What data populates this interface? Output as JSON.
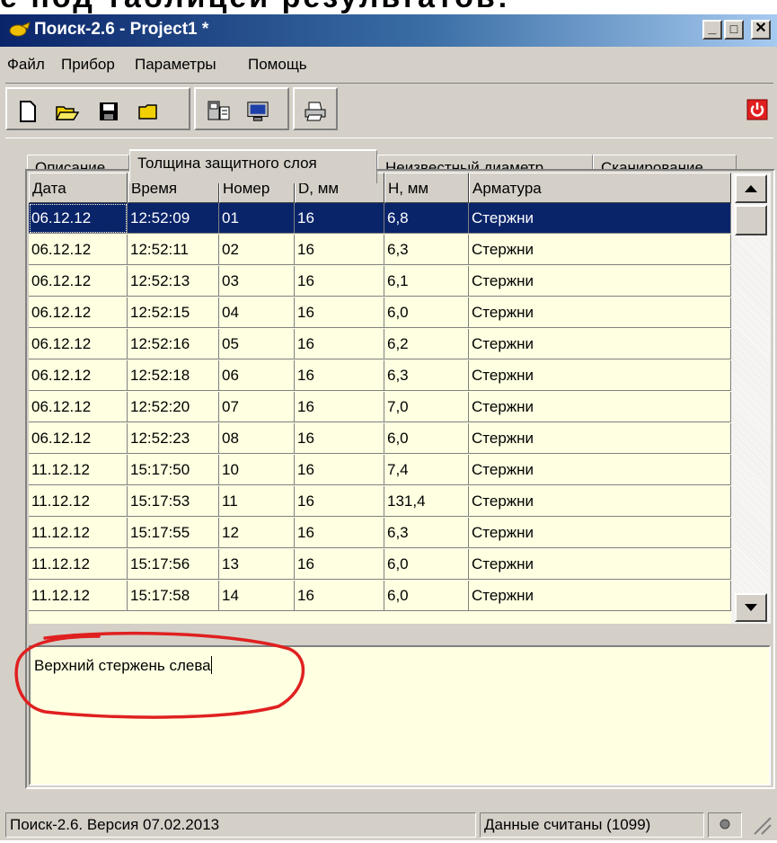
{
  "partial_caption": "е под таблицей результатов:",
  "window": {
    "title": "Поиск-2.6 - Project1 *",
    "controls": {
      "minimize": "_",
      "maximize": "□",
      "close": "✕"
    }
  },
  "menu": [
    "Файл",
    "Прибор",
    "Параметры",
    "Помощь"
  ],
  "toolbar": {
    "icons": [
      "new-file-icon",
      "open-folder-icon",
      "save-icon",
      "folder-icon",
      "device-read-icon",
      "monitor-icon",
      "print-icon",
      "power-icon"
    ],
    "colors": {
      "power": "#e02020"
    }
  },
  "tabs": [
    {
      "label": "Описание",
      "active": false
    },
    {
      "label": "Толщина защитного слоя",
      "active": true
    },
    {
      "label": "Неизвестный диаметр",
      "active": false
    },
    {
      "label": "Сканирование",
      "active": false
    }
  ],
  "table": {
    "columns": [
      "Дата",
      "Время",
      "Номер",
      "D, мм",
      "H, мм",
      "Арматура"
    ],
    "rows": [
      [
        "06.12.12",
        "12:52:09",
        "01",
        "16",
        "6,8",
        "Стержни"
      ],
      [
        "06.12.12",
        "12:52:11",
        "02",
        "16",
        "6,3",
        "Стержни"
      ],
      [
        "06.12.12",
        "12:52:13",
        "03",
        "16",
        "6,1",
        "Стержни"
      ],
      [
        "06.12.12",
        "12:52:15",
        "04",
        "16",
        "6,0",
        "Стержни"
      ],
      [
        "06.12.12",
        "12:52:16",
        "05",
        "16",
        "6,2",
        "Стержни"
      ],
      [
        "06.12.12",
        "12:52:18",
        "06",
        "16",
        "6,3",
        "Стержни"
      ],
      [
        "06.12.12",
        "12:52:20",
        "07",
        "16",
        "7,0",
        "Стержни"
      ],
      [
        "06.12.12",
        "12:52:23",
        "08",
        "16",
        "6,0",
        "Стержни"
      ],
      [
        "11.12.12",
        "15:17:50",
        "10",
        "16",
        "7,4",
        "Стержни"
      ],
      [
        "11.12.12",
        "15:17:53",
        "11",
        "16",
        "131,4",
        "Стержни"
      ],
      [
        "11.12.12",
        "15:17:55",
        "12",
        "16",
        "6,3",
        "Стержни"
      ],
      [
        "11.12.12",
        "15:17:56",
        "13",
        "16",
        "6,0",
        "Стержни"
      ],
      [
        "11.12.12",
        "15:17:58",
        "14",
        "16",
        "6,0",
        "Стержни"
      ]
    ],
    "selected_row": 0
  },
  "notes": {
    "text": "Верхний стержень слева"
  },
  "status": {
    "version": "Поиск-2.6. Версия 07.02.2013",
    "read": "Данные считаны (1099)"
  },
  "colors": {
    "selection": "#0a246a",
    "grid_background": "#ffffe1",
    "annotation": "#e02020"
  }
}
